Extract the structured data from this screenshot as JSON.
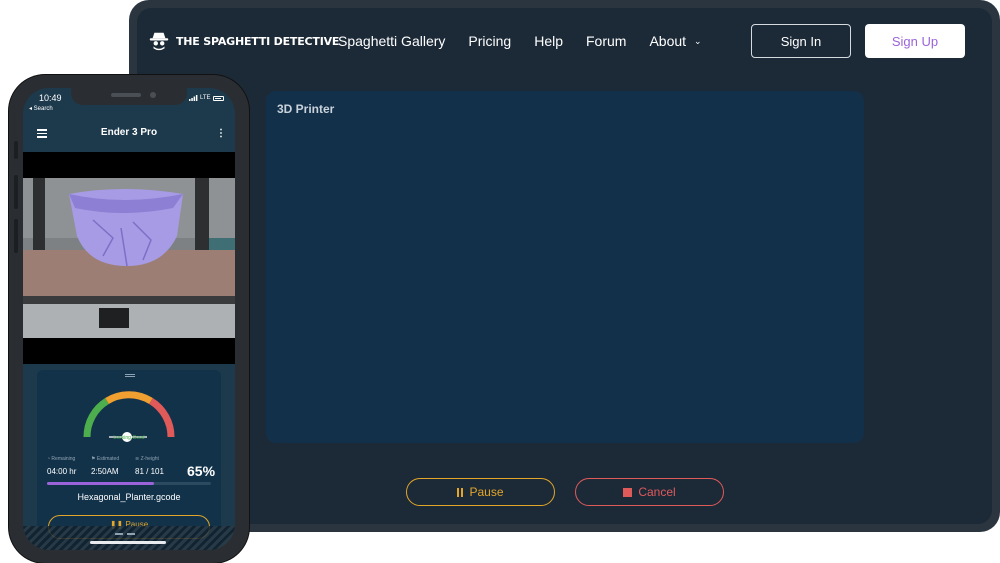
{
  "brand": {
    "name": "THE SPAGHETTI DETECTIVE"
  },
  "nav": {
    "links": [
      "Spaghetti Gallery",
      "Pricing",
      "Help",
      "Forum",
      "About"
    ],
    "sign_in": "Sign In",
    "sign_up": "Sign Up"
  },
  "dashboard": {
    "printer_label": "3D Printer",
    "pause_label": "Pause",
    "cancel_label": "Cancel"
  },
  "phone": {
    "status_time": "10:49",
    "status_back": "◂ Search",
    "status_network": "LTE",
    "app_title": "Ender 3 Pro",
    "gauge_label": "Looking Good",
    "stats": {
      "remaining_label": "Remaining",
      "remaining_value": "04:00 hr",
      "estimated_label": "Estimated",
      "estimated_value": "2:50AM",
      "zheight_label": "Z-height",
      "zheight_value": "81 / 101"
    },
    "progress_percent": "65%",
    "progress_fraction": 0.65,
    "filename": "Hexagonal_Planter.gcode",
    "pause_label": "Pause"
  },
  "colors": {
    "accent_purple": "#9b63d9",
    "pause_amber": "#e3a628",
    "cancel_red": "#e05a5a",
    "card_bg": "#13304a",
    "gauge_green": "#4cae4c"
  }
}
